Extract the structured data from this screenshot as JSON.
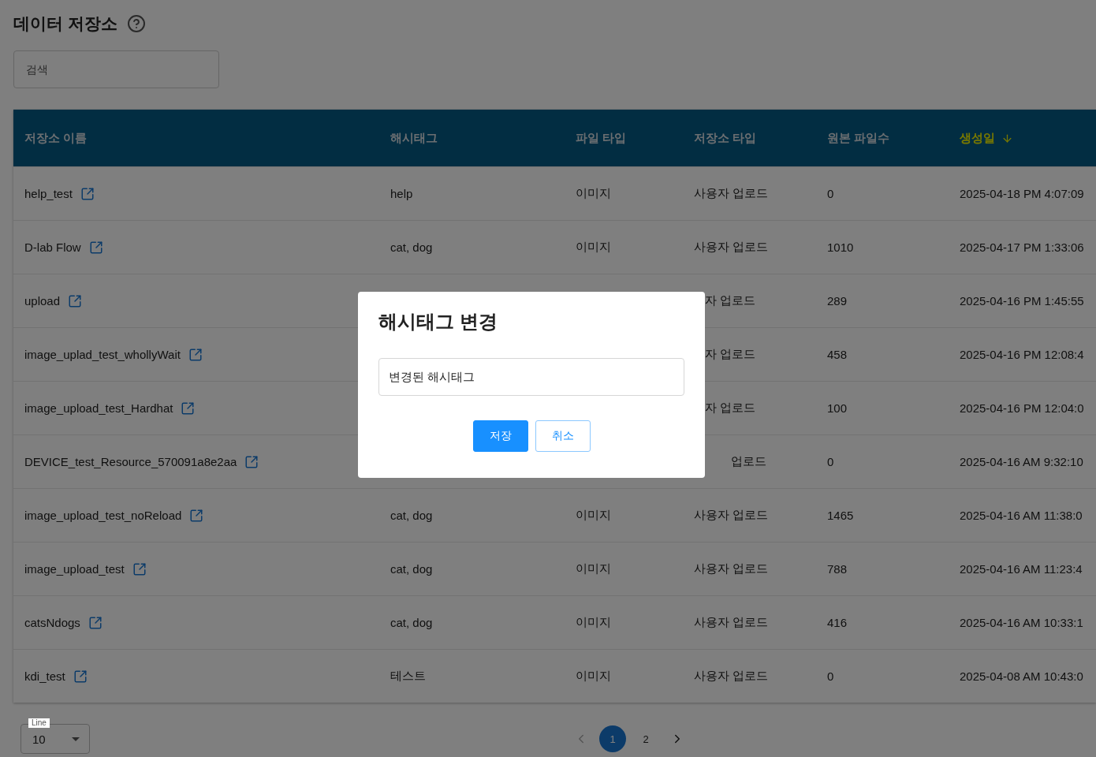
{
  "page_title": "데이터 저장소",
  "search": {
    "placeholder": "검색"
  },
  "table": {
    "columns": [
      {
        "label": "저장소 이름",
        "sorted": false
      },
      {
        "label": "해시태그",
        "sorted": false
      },
      {
        "label": "파일 타입",
        "sorted": false
      },
      {
        "label": "저장소 타입",
        "sorted": false
      },
      {
        "label": "원본 파일수",
        "sorted": false
      },
      {
        "label": "생성일",
        "sorted": true
      }
    ],
    "rows": [
      {
        "name": "help_test",
        "hashtag": "help",
        "file_type": "이미지",
        "repo_type": "사용자 업로드",
        "repo_type_cut": false,
        "count": "0",
        "created": "2025-04-18 PM 4:07:09"
      },
      {
        "name": "D-lab Flow",
        "hashtag": "cat, dog",
        "file_type": "이미지",
        "repo_type": "사용자 업로드",
        "repo_type_cut": false,
        "count": "1010",
        "created": "2025-04-17 PM 1:33:06"
      },
      {
        "name": "upload",
        "repo_type": "자 업로드",
        "repo_type_cut": true,
        "count": "289",
        "created": "2025-04-16 PM 1:45:55"
      },
      {
        "name": "image_uplad_test_whollyWait",
        "repo_type": "자 업로드",
        "repo_type_cut": true,
        "count": "458",
        "created": "2025-04-16 PM 12:08:4"
      },
      {
        "name": "image_upload_test_Hardhat",
        "repo_type": "자 업로드",
        "repo_type_cut": true,
        "count": "100",
        "created": "2025-04-16 PM 12:04:0"
      },
      {
        "name": "DEVICE_test_Resource_570091a8e2aa",
        "repo_type": "업로드",
        "repo_type_cut": true,
        "count": "0",
        "created": "2025-04-16 AM 9:32:10"
      },
      {
        "name": "image_upload_test_noReload",
        "hashtag": "cat, dog",
        "file_type": "이미지",
        "repo_type": "사용자 업로드",
        "repo_type_cut": false,
        "count": "1465",
        "created": "2025-04-16 AM 11:38:0"
      },
      {
        "name": "image_upload_test",
        "hashtag": "cat, dog",
        "file_type": "이미지",
        "repo_type": "사용자 업로드",
        "repo_type_cut": false,
        "count": "788",
        "created": "2025-04-16 AM 11:23:4"
      },
      {
        "name": "catsNdogs",
        "hashtag": "cat, dog",
        "file_type": "이미지",
        "repo_type": "사용자 업로드",
        "repo_type_cut": false,
        "count": "416",
        "created": "2025-04-16 AM 10:33:1"
      },
      {
        "name": "kdi_test",
        "hashtag": "테스트",
        "file_type": "이미지",
        "repo_type": "사용자 업로드",
        "repo_type_cut": false,
        "count": "0",
        "created": "2025-04-08 AM 10:43:0"
      }
    ]
  },
  "line_select": {
    "label": "Line",
    "value": "10"
  },
  "pagination": {
    "prev_disabled": true,
    "next_disabled": false,
    "pages": [
      {
        "label": "1",
        "selected": true
      },
      {
        "label": "2",
        "selected": false
      }
    ]
  },
  "dialog": {
    "title": "해시태그 변경",
    "value": "변경된 해시태그",
    "buttons": [
      {
        "label": "저장",
        "kind": "primary"
      },
      {
        "label": "취소",
        "kind": "secondary"
      }
    ]
  }
}
